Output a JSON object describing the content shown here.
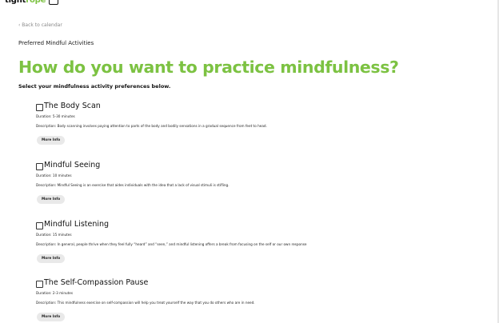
{
  "brand": {
    "logo_text_plain": "tight",
    "logo_text_accent": "rope",
    "accent_color": "#7cc242"
  },
  "nav": {
    "back_link": "‹ Back to calendar"
  },
  "page": {
    "section_label": "Preferred Mindful Activities",
    "heading": "How do you want to practice mindfulness?",
    "intro": "Select your mindfulness activity preferences below."
  },
  "activities": [
    {
      "title": "The Body Scan",
      "checked": false,
      "duration": "Duration: 5-30 minutes",
      "description": "Description: Body scanning involves paying attention to parts of the body and bodily sensations in a gradual sequence from feet to head.",
      "button_label": "More Info"
    },
    {
      "title": "Mindful Seeing",
      "checked": false,
      "duration": "Duration: 10 minutes",
      "description": "Description: Mindful Seeing is an exercise that aides individuals with the idea that a lack of visual stimuli is stifling.",
      "button_label": "More Info"
    },
    {
      "title": "Mindful Listening",
      "checked": false,
      "duration": "Duration: 15 minutes",
      "description": "Description: In general, people thrive when they feel fully “heard” and “seen,” and mindful listening offers a break from focusing on the self or our own response",
      "button_label": "More Info"
    },
    {
      "title": "The Self-Compassion Pause",
      "checked": false,
      "duration": "Duration: 2-3 minutes",
      "description": "Description: This mindfulness exercise on self-compassion will help you treat yourself the way that you do others who are in need.",
      "button_label": "More Info"
    }
  ]
}
